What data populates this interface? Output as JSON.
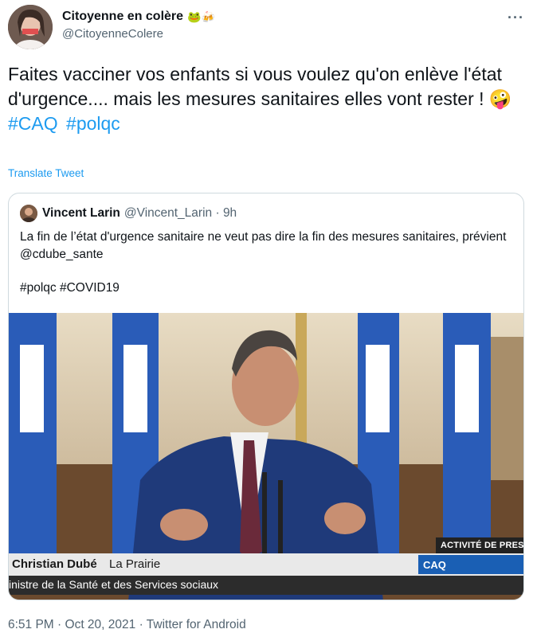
{
  "author": {
    "display_name": "Citoyenne en colère",
    "name_emojis": "🐸🍻",
    "handle": "@CitoyenneColere"
  },
  "tweet": {
    "text": "Faites vacciner vos enfants si vous voulez qu'on enlève l'état d'urgence.... mais les mesures sanitaires elles vont rester ! 🤪",
    "hashtags": [
      "#CAQ",
      "#polqc"
    ],
    "translate_label": "Translate Tweet",
    "more_icon": "more-icon"
  },
  "quoted_tweet": {
    "author_name": "Vincent Larin",
    "author_handle": "@Vincent_Larin",
    "time_ago": "9h",
    "text": "La fin de l’état d'urgence sanitaire ne veut pas dire la fin des mesures sanitaires, prévient @cdube_sante",
    "hashtags": "#polqc #COVID19",
    "media": {
      "banner_name": "Christian Dubé",
      "banner_place": "La Prairie",
      "banner_title": "inistre de la Santé et des Services sociaux",
      "caq_label": "CAQ",
      "press_label": "ACTIVITÉ DE PRESSE"
    }
  },
  "meta": {
    "time": "6:51 PM",
    "date": "Oct 20, 2021",
    "source": "Twitter for Android"
  },
  "colors": {
    "link": "#1d9bf0",
    "secondary_text": "#536471",
    "border": "#cfd9de"
  }
}
